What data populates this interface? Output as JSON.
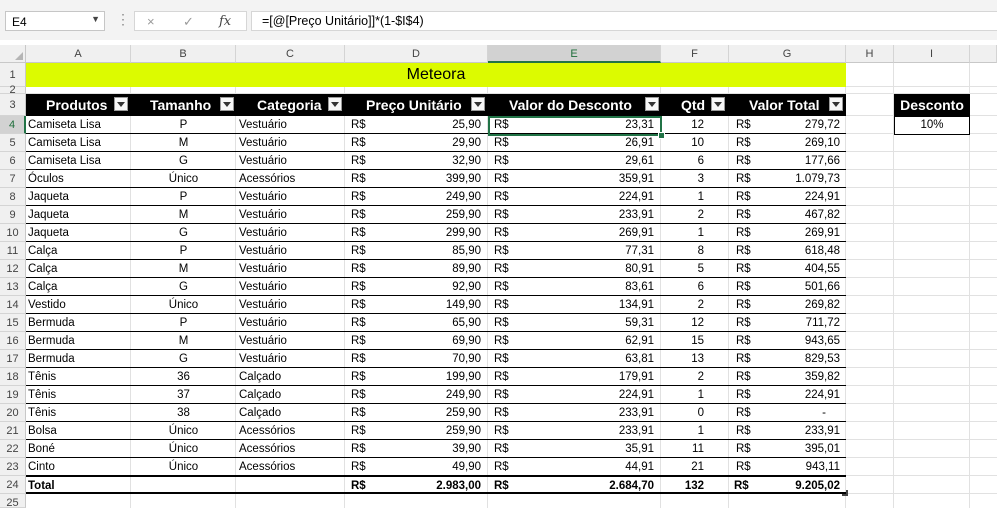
{
  "formula_bar": {
    "name_box": "E4",
    "formula": "=[@[Preço Unitário]]*(1-$I$4)",
    "cancel_icon": "×",
    "enter_icon": "✓",
    "fx_label": "fx"
  },
  "columns": [
    "A",
    "B",
    "C",
    "D",
    "E",
    "F",
    "G",
    "H",
    "I"
  ],
  "selected_column": "E",
  "row_numbers": [
    "1",
    "2",
    "3",
    "4",
    "5",
    "6",
    "7",
    "8",
    "9",
    "10",
    "11",
    "12",
    "13",
    "14",
    "15",
    "16",
    "17",
    "18",
    "19",
    "20",
    "21",
    "22",
    "23",
    "24",
    "25"
  ],
  "selected_row": "4",
  "title": "Meteora",
  "table": {
    "headers": [
      "Produtos",
      "Tamanho",
      "Categoria",
      "Preço Unitário",
      "Valor do Desconto",
      "Qtd",
      "Valor Total"
    ],
    "currency": "R$",
    "rows": [
      {
        "produto": "Camiseta Lisa",
        "tamanho": "P",
        "categoria": "Vestuário",
        "preco": "25,90",
        "desconto": "23,31",
        "qtd": "12",
        "total": "279,72"
      },
      {
        "produto": "Camiseta Lisa",
        "tamanho": "M",
        "categoria": "Vestuário",
        "preco": "29,90",
        "desconto": "26,91",
        "qtd": "10",
        "total": "269,10"
      },
      {
        "produto": "Camiseta Lisa",
        "tamanho": "G",
        "categoria": "Vestuário",
        "preco": "32,90",
        "desconto": "29,61",
        "qtd": "6",
        "total": "177,66"
      },
      {
        "produto": "Óculos",
        "tamanho": "Único",
        "categoria": "Acessórios",
        "preco": "399,90",
        "desconto": "359,91",
        "qtd": "3",
        "total": "1.079,73"
      },
      {
        "produto": "Jaqueta",
        "tamanho": "P",
        "categoria": "Vestuário",
        "preco": "249,90",
        "desconto": "224,91",
        "qtd": "1",
        "total": "224,91"
      },
      {
        "produto": "Jaqueta",
        "tamanho": "M",
        "categoria": "Vestuário",
        "preco": "259,90",
        "desconto": "233,91",
        "qtd": "2",
        "total": "467,82"
      },
      {
        "produto": "Jaqueta",
        "tamanho": "G",
        "categoria": "Vestuário",
        "preco": "299,90",
        "desconto": "269,91",
        "qtd": "1",
        "total": "269,91"
      },
      {
        "produto": "Calça",
        "tamanho": "P",
        "categoria": "Vestuário",
        "preco": "85,90",
        "desconto": "77,31",
        "qtd": "8",
        "total": "618,48"
      },
      {
        "produto": "Calça",
        "tamanho": "M",
        "categoria": "Vestuário",
        "preco": "89,90",
        "desconto": "80,91",
        "qtd": "5",
        "total": "404,55"
      },
      {
        "produto": "Calça",
        "tamanho": "G",
        "categoria": "Vestuário",
        "preco": "92,90",
        "desconto": "83,61",
        "qtd": "6",
        "total": "501,66"
      },
      {
        "produto": "Vestido",
        "tamanho": "Único",
        "categoria": "Vestuário",
        "preco": "149,90",
        "desconto": "134,91",
        "qtd": "2",
        "total": "269,82"
      },
      {
        "produto": "Bermuda",
        "tamanho": "P",
        "categoria": "Vestuário",
        "preco": "65,90",
        "desconto": "59,31",
        "qtd": "12",
        "total": "711,72"
      },
      {
        "produto": "Bermuda",
        "tamanho": "M",
        "categoria": "Vestuário",
        "preco": "69,90",
        "desconto": "62,91",
        "qtd": "15",
        "total": "943,65"
      },
      {
        "produto": "Bermuda",
        "tamanho": "G",
        "categoria": "Vestuário",
        "preco": "70,90",
        "desconto": "63,81",
        "qtd": "13",
        "total": "829,53"
      },
      {
        "produto": "Tênis",
        "tamanho": "36",
        "categoria": "Calçado",
        "preco": "199,90",
        "desconto": "179,91",
        "qtd": "2",
        "total": "359,82"
      },
      {
        "produto": "Tênis",
        "tamanho": "37",
        "categoria": "Calçado",
        "preco": "249,90",
        "desconto": "224,91",
        "qtd": "1",
        "total": "224,91"
      },
      {
        "produto": "Tênis",
        "tamanho": "38",
        "categoria": "Calçado",
        "preco": "259,90",
        "desconto": "233,91",
        "qtd": "0",
        "total": "-"
      },
      {
        "produto": "Bolsa",
        "tamanho": "Único",
        "categoria": "Acessórios",
        "preco": "259,90",
        "desconto": "233,91",
        "qtd": "1",
        "total": "233,91"
      },
      {
        "produto": "Boné",
        "tamanho": "Único",
        "categoria": "Acessórios",
        "preco": "39,90",
        "desconto": "35,91",
        "qtd": "11",
        "total": "395,01"
      },
      {
        "produto": "Cinto",
        "tamanho": "Único",
        "categoria": "Acessórios",
        "preco": "49,90",
        "desconto": "44,91",
        "qtd": "21",
        "total": "943,11"
      }
    ],
    "total_row": {
      "label": "Total",
      "preco": "2.983,00",
      "desconto": "2.684,70",
      "qtd": "132",
      "total": "9.205,02"
    }
  },
  "discount": {
    "header": "Desconto",
    "value": "10%"
  },
  "colors": {
    "title_bg": "#dcfb00",
    "header_bg": "#000000",
    "selection": "#217346"
  }
}
